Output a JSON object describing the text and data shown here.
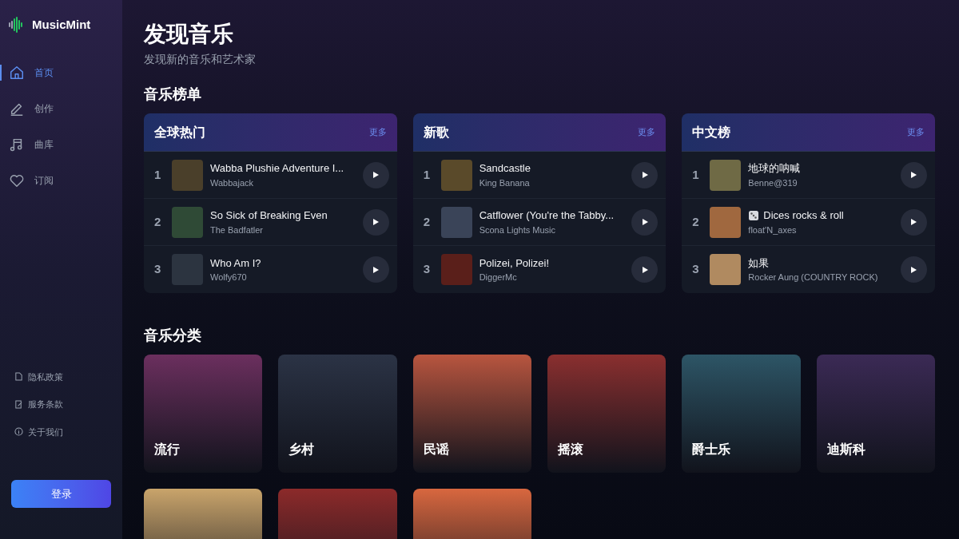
{
  "sidebar": {
    "logo": "MusicMint",
    "nav": [
      {
        "label": "首页",
        "selected": true,
        "kind": "home"
      },
      {
        "label": "创作",
        "selected": false,
        "kind": "create"
      },
      {
        "label": "曲库",
        "selected": false,
        "kind": "library"
      },
      {
        "label": "订阅",
        "selected": false,
        "kind": "subscribe"
      }
    ],
    "links": [
      {
        "label": "隐私政策",
        "kind": "privacy"
      },
      {
        "label": "服务条款",
        "kind": "terms"
      },
      {
        "label": "关于我们",
        "kind": "about"
      }
    ],
    "login_button": "登录"
  },
  "header": {
    "title": "发现音乐",
    "subtitle": "发现新的音乐和艺术家"
  },
  "charts_section": {
    "title": "音乐榜单",
    "charts": [
      {
        "title": "全球热门",
        "more": "更多",
        "tracks": [
          {
            "rank": "1",
            "title": "Wabba Plushie Adventure I...",
            "artist": "Wabbajack",
            "leading_icon": false
          },
          {
            "rank": "2",
            "title": "So Sick of Breaking Even",
            "artist": "The Badfatler",
            "leading_icon": false
          },
          {
            "rank": "3",
            "title": "Who Am I?",
            "artist": "Wolfy670",
            "leading_icon": false
          }
        ]
      },
      {
        "title": "新歌",
        "more": "更多",
        "tracks": [
          {
            "rank": "1",
            "title": "Sandcastle",
            "artist": "King Banana",
            "leading_icon": false
          },
          {
            "rank": "2",
            "title": "Catflower (You're the Tabby...",
            "artist": "Scona Lights Music",
            "leading_icon": false
          },
          {
            "rank": "3",
            "title": "Polizei, Polizei!",
            "artist": "DiggerMc",
            "leading_icon": false
          }
        ]
      },
      {
        "title": "中文榜",
        "more": "更多",
        "tracks": [
          {
            "rank": "1",
            "title": "地球的呐喊",
            "artist": "Benne@319",
            "leading_icon": false
          },
          {
            "rank": "2",
            "title": "Dices rocks & roll",
            "artist": "float'N_axes",
            "leading_icon": true
          },
          {
            "rank": "3",
            "title": "如果",
            "artist": "Rocker Aung (COUNTRY ROCK)",
            "leading_icon": false
          }
        ]
      }
    ]
  },
  "genres_section": {
    "title": "音乐分类",
    "genres": [
      {
        "label": "流行",
        "color": "#6b2f5e"
      },
      {
        "label": "乡村",
        "color": "#2b3345"
      },
      {
        "label": "民谣",
        "color": "#b8553f"
      },
      {
        "label": "摇滚",
        "color": "#8a2f2f"
      },
      {
        "label": "爵士乐",
        "color": "#2d5566"
      },
      {
        "label": "迪斯科",
        "color": "#3b2a55"
      },
      {
        "color": "#c9a46b"
      },
      {
        "color": "#8c2a2a"
      },
      {
        "color": "#d8673f"
      }
    ]
  }
}
